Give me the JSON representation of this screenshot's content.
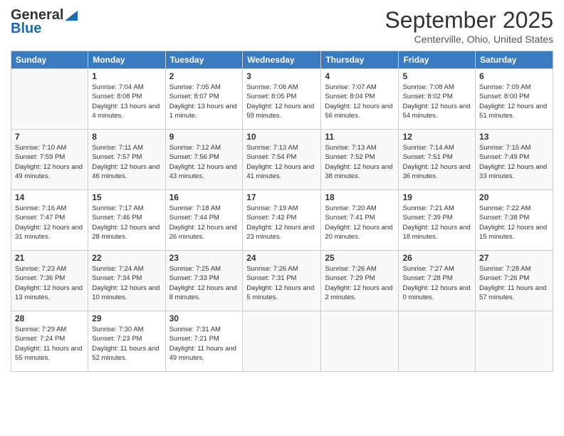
{
  "header": {
    "logo_general": "General",
    "logo_blue": "Blue",
    "month_title": "September 2025",
    "subtitle": "Centerville, Ohio, United States"
  },
  "days": [
    "Sunday",
    "Monday",
    "Tuesday",
    "Wednesday",
    "Thursday",
    "Friday",
    "Saturday"
  ],
  "weeks": [
    [
      {
        "date": "",
        "sunrise": "",
        "sunset": "",
        "daylight": ""
      },
      {
        "date": "1",
        "sunrise": "Sunrise: 7:04 AM",
        "sunset": "Sunset: 8:08 PM",
        "daylight": "Daylight: 13 hours and 4 minutes."
      },
      {
        "date": "2",
        "sunrise": "Sunrise: 7:05 AM",
        "sunset": "Sunset: 8:07 PM",
        "daylight": "Daylight: 13 hours and 1 minute."
      },
      {
        "date": "3",
        "sunrise": "Sunrise: 7:06 AM",
        "sunset": "Sunset: 8:05 PM",
        "daylight": "Daylight: 12 hours and 59 minutes."
      },
      {
        "date": "4",
        "sunrise": "Sunrise: 7:07 AM",
        "sunset": "Sunset: 8:04 PM",
        "daylight": "Daylight: 12 hours and 56 minutes."
      },
      {
        "date": "5",
        "sunrise": "Sunrise: 7:08 AM",
        "sunset": "Sunset: 8:02 PM",
        "daylight": "Daylight: 12 hours and 54 minutes."
      },
      {
        "date": "6",
        "sunrise": "Sunrise: 7:09 AM",
        "sunset": "Sunset: 8:00 PM",
        "daylight": "Daylight: 12 hours and 51 minutes."
      }
    ],
    [
      {
        "date": "7",
        "sunrise": "Sunrise: 7:10 AM",
        "sunset": "Sunset: 7:59 PM",
        "daylight": "Daylight: 12 hours and 49 minutes."
      },
      {
        "date": "8",
        "sunrise": "Sunrise: 7:11 AM",
        "sunset": "Sunset: 7:57 PM",
        "daylight": "Daylight: 12 hours and 46 minutes."
      },
      {
        "date": "9",
        "sunrise": "Sunrise: 7:12 AM",
        "sunset": "Sunset: 7:56 PM",
        "daylight": "Daylight: 12 hours and 43 minutes."
      },
      {
        "date": "10",
        "sunrise": "Sunrise: 7:13 AM",
        "sunset": "Sunset: 7:54 PM",
        "daylight": "Daylight: 12 hours and 41 minutes."
      },
      {
        "date": "11",
        "sunrise": "Sunrise: 7:13 AM",
        "sunset": "Sunset: 7:52 PM",
        "daylight": "Daylight: 12 hours and 38 minutes."
      },
      {
        "date": "12",
        "sunrise": "Sunrise: 7:14 AM",
        "sunset": "Sunset: 7:51 PM",
        "daylight": "Daylight: 12 hours and 36 minutes."
      },
      {
        "date": "13",
        "sunrise": "Sunrise: 7:15 AM",
        "sunset": "Sunset: 7:49 PM",
        "daylight": "Daylight: 12 hours and 33 minutes."
      }
    ],
    [
      {
        "date": "14",
        "sunrise": "Sunrise: 7:16 AM",
        "sunset": "Sunset: 7:47 PM",
        "daylight": "Daylight: 12 hours and 31 minutes."
      },
      {
        "date": "15",
        "sunrise": "Sunrise: 7:17 AM",
        "sunset": "Sunset: 7:46 PM",
        "daylight": "Daylight: 12 hours and 28 minutes."
      },
      {
        "date": "16",
        "sunrise": "Sunrise: 7:18 AM",
        "sunset": "Sunset: 7:44 PM",
        "daylight": "Daylight: 12 hours and 26 minutes."
      },
      {
        "date": "17",
        "sunrise": "Sunrise: 7:19 AM",
        "sunset": "Sunset: 7:42 PM",
        "daylight": "Daylight: 12 hours and 23 minutes."
      },
      {
        "date": "18",
        "sunrise": "Sunrise: 7:20 AM",
        "sunset": "Sunset: 7:41 PM",
        "daylight": "Daylight: 12 hours and 20 minutes."
      },
      {
        "date": "19",
        "sunrise": "Sunrise: 7:21 AM",
        "sunset": "Sunset: 7:39 PM",
        "daylight": "Daylight: 12 hours and 18 minutes."
      },
      {
        "date": "20",
        "sunrise": "Sunrise: 7:22 AM",
        "sunset": "Sunset: 7:38 PM",
        "daylight": "Daylight: 12 hours and 15 minutes."
      }
    ],
    [
      {
        "date": "21",
        "sunrise": "Sunrise: 7:23 AM",
        "sunset": "Sunset: 7:36 PM",
        "daylight": "Daylight: 12 hours and 13 minutes."
      },
      {
        "date": "22",
        "sunrise": "Sunrise: 7:24 AM",
        "sunset": "Sunset: 7:34 PM",
        "daylight": "Daylight: 12 hours and 10 minutes."
      },
      {
        "date": "23",
        "sunrise": "Sunrise: 7:25 AM",
        "sunset": "Sunset: 7:33 PM",
        "daylight": "Daylight: 12 hours and 8 minutes."
      },
      {
        "date": "24",
        "sunrise": "Sunrise: 7:26 AM",
        "sunset": "Sunset: 7:31 PM",
        "daylight": "Daylight: 12 hours and 5 minutes."
      },
      {
        "date": "25",
        "sunrise": "Sunrise: 7:26 AM",
        "sunset": "Sunset: 7:29 PM",
        "daylight": "Daylight: 12 hours and 2 minutes."
      },
      {
        "date": "26",
        "sunrise": "Sunrise: 7:27 AM",
        "sunset": "Sunset: 7:28 PM",
        "daylight": "Daylight: 12 hours and 0 minutes."
      },
      {
        "date": "27",
        "sunrise": "Sunrise: 7:28 AM",
        "sunset": "Sunset: 7:26 PM",
        "daylight": "Daylight: 11 hours and 57 minutes."
      }
    ],
    [
      {
        "date": "28",
        "sunrise": "Sunrise: 7:29 AM",
        "sunset": "Sunset: 7:24 PM",
        "daylight": "Daylight: 11 hours and 55 minutes."
      },
      {
        "date": "29",
        "sunrise": "Sunrise: 7:30 AM",
        "sunset": "Sunset: 7:23 PM",
        "daylight": "Daylight: 11 hours and 52 minutes."
      },
      {
        "date": "30",
        "sunrise": "Sunrise: 7:31 AM",
        "sunset": "Sunset: 7:21 PM",
        "daylight": "Daylight: 11 hours and 49 minutes."
      },
      {
        "date": "",
        "sunrise": "",
        "sunset": "",
        "daylight": ""
      },
      {
        "date": "",
        "sunrise": "",
        "sunset": "",
        "daylight": ""
      },
      {
        "date": "",
        "sunrise": "",
        "sunset": "",
        "daylight": ""
      },
      {
        "date": "",
        "sunrise": "",
        "sunset": "",
        "daylight": ""
      }
    ]
  ]
}
